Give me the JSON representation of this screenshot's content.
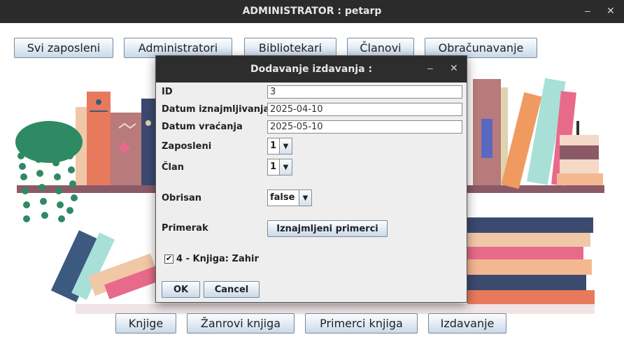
{
  "window": {
    "title": "ADMINISTRATOR : petarp",
    "minimize": "–",
    "close": "✕"
  },
  "top_menu": [
    {
      "label": "Svi zaposleni"
    },
    {
      "label": "Administratori"
    },
    {
      "label": "Bibliotekari"
    },
    {
      "label": "Članovi"
    },
    {
      "label": "Obračunavanje"
    }
  ],
  "bottom_menu": [
    {
      "label": "Knjige"
    },
    {
      "label": "Žanrovi knjiga"
    },
    {
      "label": "Primerci knjiga"
    },
    {
      "label": "Izdavanje"
    }
  ],
  "dialog": {
    "title": "Dodavanje izdavanja :",
    "minimize": "–",
    "close": "✕",
    "fields": {
      "id": {
        "label": "ID",
        "value": "3"
      },
      "datum_iznajmljivanja": {
        "label": "Datum iznajmljivanja",
        "value": "2025-04-10"
      },
      "datum_vracanja": {
        "label": "Datum vraćanja",
        "value": "2025-05-10"
      },
      "zaposleni": {
        "label": "Zaposleni",
        "value": "1"
      },
      "clan": {
        "label": "Član",
        "value": "1"
      },
      "obrisan": {
        "label": "Obrisan",
        "value": "false"
      },
      "primerak": {
        "label": "Primerak",
        "button": "Iznajmljeni primerci"
      }
    },
    "checkbox": {
      "label": "4 - Knjiga: Zahir",
      "checked": true
    },
    "ok": "OK",
    "cancel": "Cancel"
  },
  "colors": {
    "titlebar": "#2b2b2b",
    "dialog_bg": "#eeeeee",
    "button_top": "#fdfeff",
    "button_bottom": "#c9d9e8",
    "shelf": "#8a5a68"
  }
}
